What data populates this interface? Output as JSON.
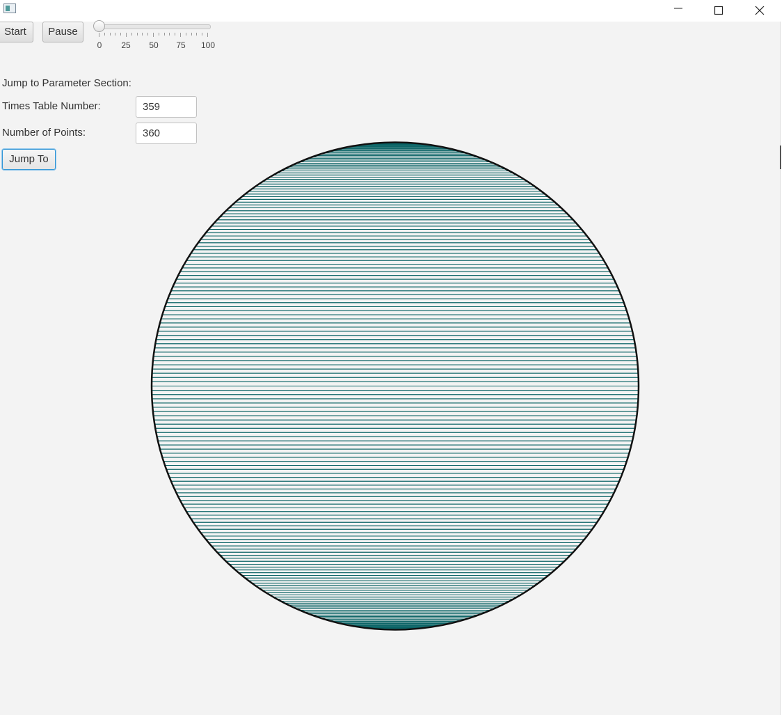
{
  "window": {
    "title": "",
    "icon": "app-window-icon",
    "controls": [
      "minimize-icon",
      "maximize-icon",
      "close-icon"
    ]
  },
  "toolbar": {
    "start_label": "Start",
    "pause_label": "Pause",
    "speed_slider": {
      "min": 0,
      "max": 100,
      "value": 0,
      "tick_labels": [
        "0",
        "25",
        "50",
        "75",
        "100"
      ]
    }
  },
  "params": {
    "section_label": "Jump to Parameter Section:",
    "times_table_label": "Times Table Number:",
    "times_table_value": "359",
    "points_label": "Number of Points:",
    "points_value": "360",
    "jump_label": "Jump To"
  },
  "visualization": {
    "multiplier": 359,
    "points": 360,
    "line_color": "#0b6466",
    "circle_color": "#111111"
  }
}
